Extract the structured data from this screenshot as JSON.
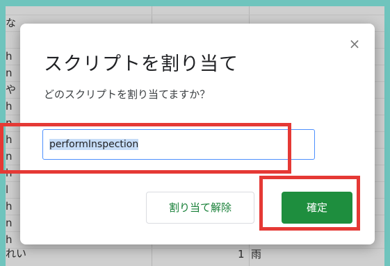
{
  "background_sheet": {
    "left_col_chars": [
      "な",
      "h",
      "n",
      "や",
      "h",
      "n",
      "h",
      "n",
      "h",
      "l",
      "h",
      "n",
      "h",
      "れい"
    ],
    "bottom_row": {
      "number": "1",
      "text": "雨"
    }
  },
  "dialog": {
    "title": "スクリプトを割り当て",
    "close_glyph": "×",
    "prompt": "どのスクリプトを割り当てますか？",
    "input_value": "performInspection",
    "buttons": {
      "unassign": "割り当て解除",
      "ok": "確定"
    }
  },
  "colors": {
    "frame": "#6fc4bd",
    "annotation": "#e53935",
    "primary_button": "#1e8e3e",
    "secondary_text": "#188038",
    "input_border": "#4d90fe"
  }
}
